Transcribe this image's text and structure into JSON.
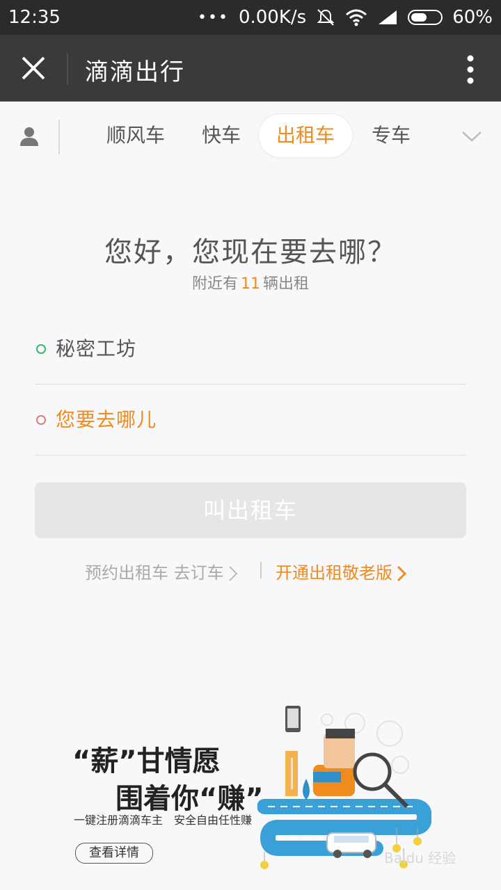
{
  "status_bar": {
    "time": "12:35",
    "dots": "•••",
    "network_speed": "0.00K/s",
    "battery_percent": "60%",
    "battery_level": 0.6,
    "icons": [
      "mute-icon",
      "wifi-icon",
      "signal-icon",
      "battery-icon"
    ]
  },
  "app_bar": {
    "title": "滴滴出行",
    "close_icon": "close-icon",
    "more_icon": "more-vertical-icon"
  },
  "tabs": {
    "items": [
      {
        "label": "顺风车",
        "active": false
      },
      {
        "label": "快车",
        "active": false
      },
      {
        "label": "出租车",
        "active": true
      },
      {
        "label": "专车",
        "active": false
      }
    ],
    "avatar_icon": "user-icon",
    "expand_icon": "chevron-down-icon"
  },
  "main": {
    "greeting": "您好，您现在要去哪？",
    "nearby_prefix": "附近有",
    "nearby_count": "11",
    "nearby_suffix": "辆出租",
    "from_value": "秘密工坊",
    "to_placeholder": "您要去哪儿",
    "call_button": "叫出租车",
    "reserve_link": "预约出租车 去订车",
    "elder_link": "开通出租敬老版"
  },
  "banner": {
    "headline_1": "“薪”甘情愿",
    "headline_2": "围着你“赚”",
    "description": "一键注册滴滴车主　安全自由任性赚",
    "details_button": "查看详情",
    "watermark": "Baidu 经验"
  },
  "colors": {
    "accent": "#f08b1e",
    "from_dot": "#3cb371",
    "to_dot": "#e07a7a",
    "appbar": "#3a3a3a",
    "statusbar": "#2b2b2b"
  }
}
